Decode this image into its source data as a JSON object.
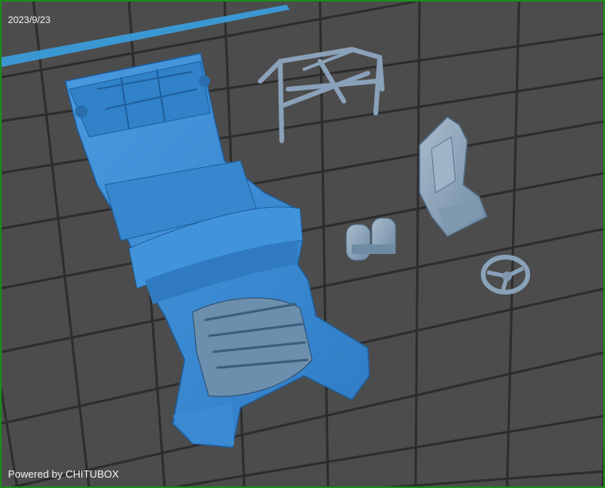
{
  "viewport": {
    "date": "2023/9/23",
    "powered_by": "Powered by CHITUBOX"
  },
  "models": [
    {
      "name": "car-chassis"
    },
    {
      "name": "roll-cage"
    },
    {
      "name": "racing-seat"
    },
    {
      "name": "nitrous-tanks"
    },
    {
      "name": "steering-wheel"
    }
  ],
  "colors": {
    "model_blue": "#3d8fd6",
    "model_shadow": "#2a6eb0",
    "model_gray": "#8fa8c0",
    "grid_line": "#2e2e2e",
    "floor": "#4c4c4c",
    "border_green": "#1e8a1e",
    "plate_edge": "#3aa0e0"
  }
}
